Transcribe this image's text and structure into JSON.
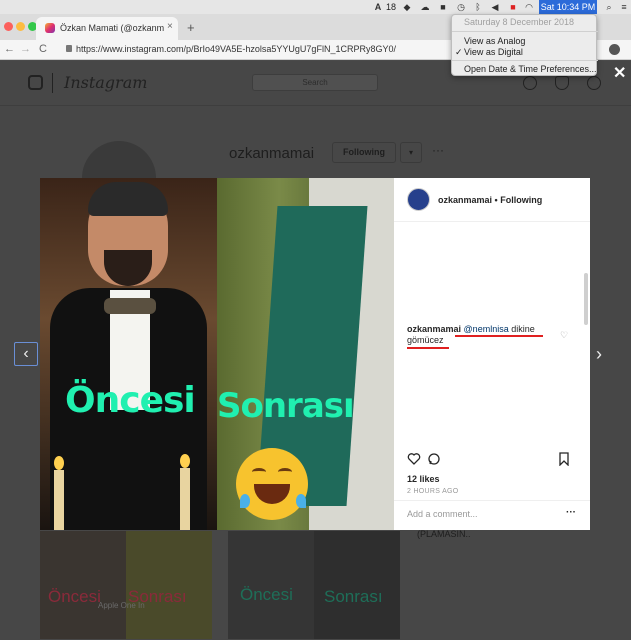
{
  "menubar": {
    "battery_count": "18",
    "clock": "Sat 10:34 PM"
  },
  "date_menu": {
    "date": "Saturday 8 December 2018",
    "items": [
      "View as Analog",
      "View as Digital",
      "Open Date & Time Preferences..."
    ],
    "checked_item": "View as Digital"
  },
  "browser": {
    "tab_title": "Özkan Mamati (@ozkanmamai",
    "tab_close": "×",
    "new_tab": "+",
    "url": "https://www.instagram.com/p/BrIo49VA5E-hzolsa5YYUgU7gFlN_1CRPRy8GY0/",
    "back": "←",
    "forward": "→",
    "reload": "C"
  },
  "instagram": {
    "wordmark": "Instagram",
    "search_placeholder": "Search",
    "profile_username": "ozkanmamai",
    "following_button": "Following",
    "caret": "▾",
    "more": "···",
    "side_text": "(PLAMASIN..",
    "grid": [
      {
        "a": "Öncesi",
        "b": "Sonrası",
        "note": "Apple One In"
      },
      {
        "a": "Öncesi",
        "b": "Sonrası"
      }
    ]
  },
  "post": {
    "header_user": "ozkanmamai",
    "header_sep": "•",
    "header_status": "Following",
    "image_text_left": "Öncesi",
    "image_text_right": "Sonrası",
    "comment_user": "ozkanmamai",
    "comment_mention": "@nemlnisa",
    "comment_text": " dikine",
    "comment_text2": "gömücez",
    "likes": "12 likes",
    "time_ago": "2 HOURS AGO",
    "add_comment_placeholder": "Add a comment...",
    "options": "···"
  },
  "colors": {
    "overlay_text": "#20f0b0",
    "accent_blue": "#2c6bd9",
    "underline_red": "#e02020"
  }
}
